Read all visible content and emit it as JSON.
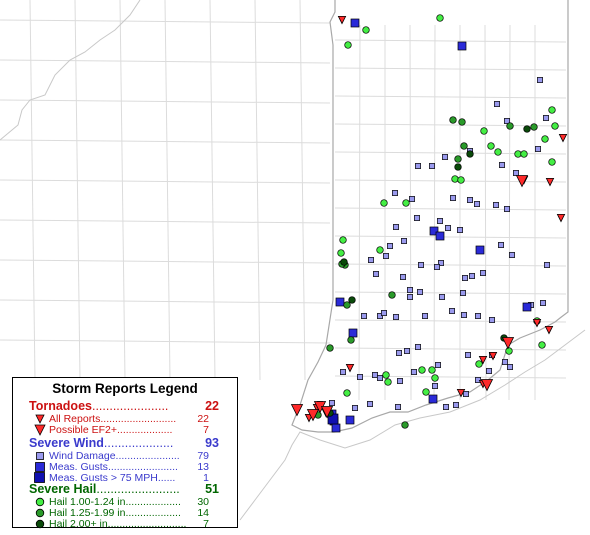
{
  "colors": {
    "tornado": "#cc1111",
    "tornado_fill": "#ff2a2a",
    "wind_text": "#3a3acc",
    "wind_small": "#9a9aee",
    "wind_meas": "#2a2ad8",
    "wind_big": "#1010b0",
    "hail_text": "#006600",
    "hail_light": "#44ee44",
    "hail_mid": "#2a9a2a",
    "hail_dark": "#0a4a0a",
    "border": "#d8d8d8",
    "state": "#b0b0b0"
  },
  "legend": {
    "title": "Storm Reports Legend",
    "tornadoes": {
      "label": "Tornadoes",
      "dots": "......................",
      "count": "22",
      "items": [
        {
          "label": "All Reports",
          "dots": "..........................",
          "count": "22",
          "icon": "small-red-triangle-icon"
        },
        {
          "label": "Possible EF2+",
          "dots": "...................",
          "count": "7",
          "icon": "large-red-triangle-icon"
        }
      ]
    },
    "wind": {
      "label": "Severe Wind",
      "dots": "....................",
      "count": "93",
      "items": [
        {
          "label": "Wind Damage",
          "dots": "......................",
          "count": "79",
          "icon": "light-blue-square-icon"
        },
        {
          "label": "Meas. Gusts",
          "dots": "........................",
          "count": "13",
          "icon": "blue-square-icon"
        },
        {
          "label": "Meas. Gusts > 75 MPH",
          "dots": "......",
          "count": "1",
          "icon": "dark-blue-square-icon"
        }
      ]
    },
    "hail": {
      "label": "Severe Hail",
      "dots": "........................",
      "count": "51",
      "items": [
        {
          "label": "Hail 1.00-1.24 in",
          "dots": "...................",
          "count": "30",
          "icon": "light-green-circle-icon"
        },
        {
          "label": "Hail 1.25-1.99 in",
          "dots": "...................",
          "count": "14",
          "icon": "green-circle-icon"
        },
        {
          "label": "Hail 2.00+ in",
          "dots": "...........................",
          "count": "7",
          "icon": "dark-green-circle-icon"
        }
      ]
    }
  }
}
